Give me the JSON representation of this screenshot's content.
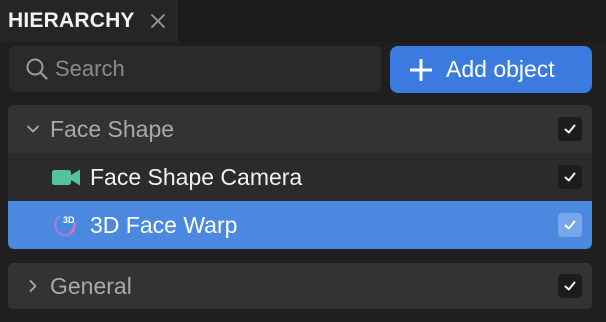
{
  "tab": {
    "title": "HIERARCHY"
  },
  "search": {
    "placeholder": "Search"
  },
  "toolbar": {
    "add_label": "Add object"
  },
  "groups": [
    {
      "label": "Face Shape",
      "expanded": true,
      "checked": true,
      "items": [
        {
          "label": "Face Shape Camera",
          "icon": "camera-icon",
          "checked": true,
          "selected": false
        },
        {
          "label": "3D Face Warp",
          "icon": "face-warp-3d-icon",
          "checked": true,
          "selected": true
        }
      ]
    },
    {
      "label": "General",
      "expanded": false,
      "checked": true,
      "items": []
    }
  ],
  "colors": {
    "accent": "#3b7be0",
    "selected_row": "#4b88e0",
    "camera_icon": "#55c39a",
    "face_warp_icon": "#9b7fd6"
  }
}
